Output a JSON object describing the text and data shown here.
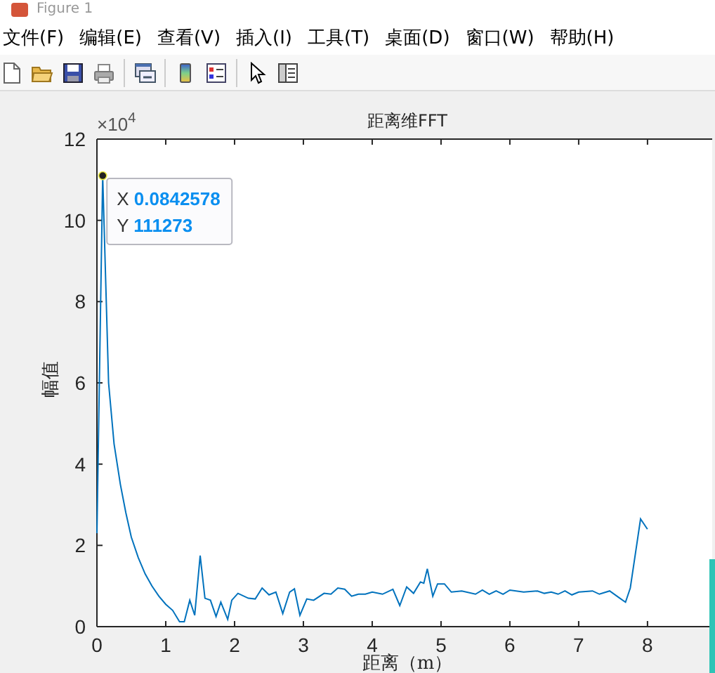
{
  "window": {
    "title": "Figure 1"
  },
  "menu": [
    "文件(F)",
    "编辑(E)",
    "查看(V)",
    "插入(I)",
    "工具(T)",
    "桌面(D)",
    "窗口(W)",
    "帮助(H)"
  ],
  "toolbar": [
    {
      "kind": "new"
    },
    {
      "kind": "open"
    },
    {
      "kind": "save"
    },
    {
      "kind": "print"
    },
    {
      "kind": "sep"
    },
    {
      "kind": "link"
    },
    {
      "kind": "sep"
    },
    {
      "kind": "colorbar"
    },
    {
      "kind": "legend"
    },
    {
      "kind": "sep"
    },
    {
      "kind": "pointer"
    },
    {
      "kind": "property"
    }
  ],
  "chart_data": {
    "type": "line",
    "title": "距离维FFT",
    "xlabel": "距离（m）",
    "ylabel": "幅值",
    "x": [
      0,
      0.084,
      0.17,
      0.25,
      0.34,
      0.42,
      0.5,
      0.6,
      0.7,
      0.8,
      0.9,
      1.0,
      1.1,
      1.2,
      1.27,
      1.35,
      1.42,
      1.5,
      1.57,
      1.65,
      1.73,
      1.8,
      1.9,
      1.96,
      2.05,
      2.2,
      2.3,
      2.4,
      2.5,
      2.6,
      2.7,
      2.8,
      2.87,
      2.95,
      3.05,
      3.15,
      3.3,
      3.4,
      3.5,
      3.6,
      3.7,
      3.8,
      3.9,
      4.0,
      4.15,
      4.3,
      4.4,
      4.5,
      4.6,
      4.7,
      4.75,
      4.8,
      4.88,
      4.95,
      5.05,
      5.15,
      5.3,
      5.5,
      5.6,
      5.7,
      5.8,
      5.9,
      6.0,
      6.2,
      6.4,
      6.5,
      6.6,
      6.7,
      6.8,
      6.9,
      7.0,
      7.2,
      7.3,
      7.45,
      7.6,
      7.68,
      7.75,
      7.9,
      8.0
    ],
    "series": [
      {
        "color": "#0072bd",
        "values": [
          2.3,
          11.1,
          6,
          4.5,
          3.5,
          2.8,
          2.2,
          1.7,
          1.3,
          1,
          0.75,
          0.55,
          0.4,
          0.12,
          0.12,
          0.65,
          0.28,
          1.75,
          0.7,
          0.65,
          0.25,
          0.6,
          0.18,
          0.65,
          0.82,
          0.7,
          0.68,
          0.95,
          0.78,
          0.85,
          0.32,
          0.85,
          0.93,
          0.28,
          0.68,
          0.65,
          0.82,
          0.8,
          0.95,
          0.92,
          0.75,
          0.8,
          0.8,
          0.85,
          0.8,
          0.92,
          0.52,
          0.98,
          0.82,
          1.1,
          1.07,
          1.42,
          0.75,
          1.05,
          1.05,
          0.85,
          0.88,
          0.8,
          0.9,
          0.8,
          0.88,
          0.8,
          0.9,
          0.85,
          0.88,
          0.82,
          0.85,
          0.8,
          0.88,
          0.78,
          0.85,
          0.88,
          0.8,
          0.88,
          0.7,
          0.6,
          0.95,
          2.65,
          2.4
        ]
      }
    ],
    "xlim": [
      0,
      8.94
    ],
    "ylim": [
      0,
      12
    ],
    "xticks": [
      0,
      1,
      2,
      3,
      4,
      5,
      6,
      7,
      8
    ],
    "yticks": [
      0,
      2,
      4,
      6,
      8,
      10,
      12
    ]
  },
  "axis_exponent": {
    "base": "×10",
    "power": "4"
  },
  "datatip": {
    "lines": [
      {
        "label": "X",
        "value": "0.0842578"
      },
      {
        "label": "Y",
        "value": "111273"
      }
    ]
  }
}
